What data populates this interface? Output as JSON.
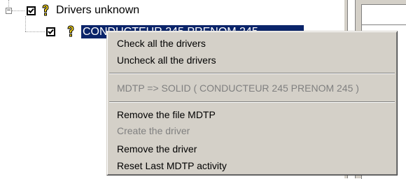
{
  "tree": {
    "expander_symbol": "−",
    "root": {
      "label": "Drivers unknown",
      "checked": true,
      "icon": "question-mark-icon"
    },
    "child": {
      "label": "CONDUCTEUR 245 PRENOM 245",
      "checked": true,
      "icon": "question-mark-icon",
      "selected": true
    }
  },
  "context_menu": {
    "items": [
      {
        "label": "Check all the drivers",
        "enabled": true
      },
      {
        "label": "Uncheck all the drivers",
        "enabled": true
      },
      {
        "label": "MDTP => SOLID  ( CONDUCTEUR 245 PRENOM 245 )",
        "enabled": false
      },
      {
        "label": "Remove the file MDTP",
        "enabled": true
      },
      {
        "label": "Create the driver",
        "enabled": false
      },
      {
        "label": "Remove the driver",
        "enabled": true
      },
      {
        "label": "Reset  Last MDTP activity",
        "enabled": true
      }
    ]
  },
  "colors": {
    "selection": "#0a246a",
    "menu_background": "#d4d0c8",
    "disabled_text": "#808080",
    "question_icon": "#f2d21a"
  }
}
